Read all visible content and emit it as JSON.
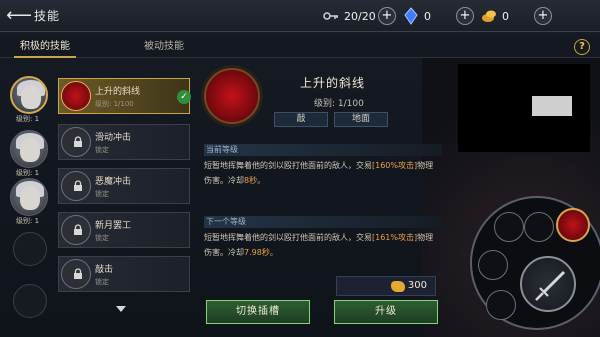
{
  "header": {
    "title": "技能",
    "resources": [
      {
        "icon": "key-icon",
        "value": "20/20"
      },
      {
        "icon": "blue-crystal-icon",
        "value": "0"
      },
      {
        "icon": "gold-coin-icon",
        "value": "0"
      }
    ]
  },
  "tabs": [
    {
      "label": "积极的技能",
      "active": true
    },
    {
      "label": "被动技能",
      "active": false
    }
  ],
  "help": "?",
  "characters": [
    {
      "level": "级别: 1",
      "selected": true
    },
    {
      "level": "级别: 1",
      "selected": false
    },
    {
      "level": "级别: 1",
      "selected": false
    }
  ],
  "skills": [
    {
      "name": "上升的斜线",
      "sub": "级别: 1/100",
      "selected": true,
      "equipped": true
    },
    {
      "name": "滑动冲击",
      "sub": "锁定",
      "selected": false
    },
    {
      "name": "恶魔冲击",
      "sub": "锁定",
      "selected": false
    },
    {
      "name": "新月罢工",
      "sub": "锁定",
      "selected": false
    },
    {
      "name": "敲击",
      "sub": "锁定",
      "selected": false
    }
  ],
  "detail": {
    "name": "上升的斜线",
    "level": "级别: 1/100",
    "tags": [
      "敲",
      "地面"
    ],
    "current_title": "当前等级",
    "current_desc_a": "短暂地挥舞着他的剑以殴打他面前的敌人，交易",
    "current_pct": "[160%攻击]",
    "current_desc_b": "物理伤害。冷却",
    "current_cd": "8秒。",
    "next_title": "下一个等级",
    "next_desc_a": "短暂地挥舞着他的剑以殴打他面前的敌人，交易",
    "next_pct": "[161%攻击]",
    "next_desc_b": "物理伤害。冷却",
    "next_cd": "7.98秒。",
    "cost": "300",
    "switch_slot": "切换插槽",
    "upgrade": "升级"
  },
  "colors": {
    "accent_gold": "#c9a64e",
    "skill_red": "#c0121a",
    "highlight": "#e9a24a",
    "button_green": "#2d5e33"
  }
}
